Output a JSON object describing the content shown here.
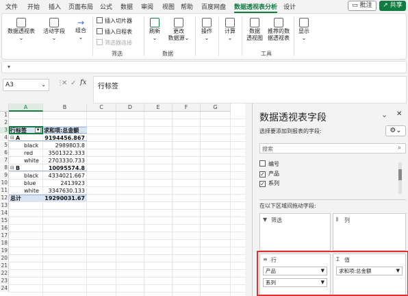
{
  "menu": [
    "文件",
    "开始",
    "插入",
    "页面布局",
    "公式",
    "数据",
    "审阅",
    "视图",
    "帮助",
    "百度网盘",
    "数据透视表分析",
    "设计"
  ],
  "menu_active_index": 10,
  "top_buttons": {
    "comment": "批注",
    "share": "共享"
  },
  "ribbon": {
    "pivot_table": "数据透视表",
    "active_field": "活动字段",
    "group": "组合",
    "insert_slicer": "插入切片器",
    "insert_timeline": "插入日程表",
    "filter_connections": "筛选器连接",
    "filter_group": "筛选",
    "refresh": "刷新",
    "change_source_1": "更改",
    "change_source_2": "数据源",
    "data_group": "数据",
    "actions": "操作",
    "calculations": "计算",
    "pivot_chart_1": "数据",
    "pivot_chart_2": "透视图",
    "recommended_1": "推荐的数",
    "recommended_2": "据透视表",
    "tools_group": "工具",
    "show": "显示"
  },
  "name_box": "A3",
  "formula_value": "行标签",
  "columns": [
    "A",
    "B",
    "C",
    "D",
    "E",
    "F",
    "G"
  ],
  "rows": [
    "1",
    "2",
    "3",
    "4",
    "5",
    "6",
    "7",
    "8",
    "9",
    "10",
    "11",
    "12",
    "13",
    "14",
    "15",
    "16",
    "17",
    "18",
    "19",
    "20",
    "21",
    "22",
    "23",
    "24"
  ],
  "pivot": {
    "header_label": "行标签",
    "header_value": "求和项:总金额",
    "groups": [
      {
        "name": "A",
        "total": "9194456.867",
        "items": [
          [
            "black",
            "2989803.8"
          ],
          [
            "red",
            "3501322.333"
          ],
          [
            "white",
            "2703330.733"
          ]
        ]
      },
      {
        "name": "B",
        "total": "10095574.8",
        "items": [
          [
            "black",
            "4334021.667"
          ],
          [
            "blue",
            "2413923"
          ],
          [
            "white",
            "3347630.133"
          ]
        ]
      }
    ],
    "grand_label": "总计",
    "grand_value": "19290031.67"
  },
  "pane": {
    "title": "数据透视表字段",
    "subtitle": "选择要添加到报表的字段:",
    "search_placeholder": "搜索",
    "fields": [
      {
        "label": "编号",
        "checked": false
      },
      {
        "label": "产品",
        "checked": true
      },
      {
        "label": "系列",
        "checked": true
      }
    ],
    "drag_hint": "在以下区域间拖动字段:",
    "zone_filter": "筛选",
    "zone_columns": "列",
    "zone_rows": "行",
    "zone_values": "值",
    "row_fields": [
      "产品",
      "系列"
    ],
    "value_fields": [
      "求和项:总金额"
    ]
  },
  "highlight_color": "#e03030",
  "accent_color": "#107c41"
}
